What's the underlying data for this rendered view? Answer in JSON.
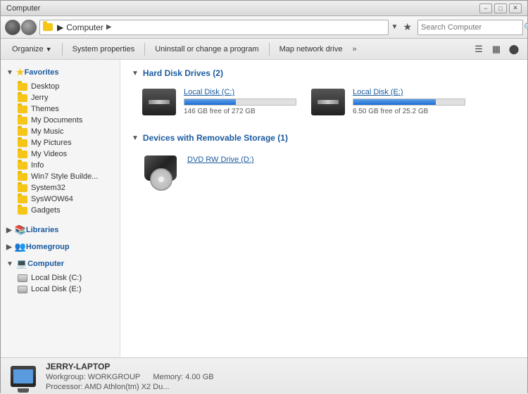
{
  "window": {
    "title": "Computer",
    "min_btn": "−",
    "max_btn": "□",
    "close_btn": "✕"
  },
  "addressbar": {
    "breadcrumb_icon": "folder",
    "breadcrumb_text": "Computer",
    "breadcrumb_arrow": "▶",
    "placeholder": "Search Computer",
    "star": "★",
    "dropdown_arrow": "▼"
  },
  "toolbar": {
    "organize_label": "Organize",
    "system_properties_label": "System properties",
    "uninstall_label": "Uninstall or change a program",
    "map_network_label": "Map network drive",
    "more_label": "»"
  },
  "sidebar": {
    "favorites_label": "Favorites",
    "favorites_items": [
      {
        "label": "Desktop"
      },
      {
        "label": "Jerry"
      },
      {
        "label": "Themes"
      },
      {
        "label": "My Documents"
      },
      {
        "label": "My Music"
      },
      {
        "label": "My Pictures"
      },
      {
        "label": "My Videos"
      },
      {
        "label": "Info"
      },
      {
        "label": "Win7 Style Builde..."
      },
      {
        "label": "System32"
      },
      {
        "label": "SysWOW64"
      },
      {
        "label": "Gadgets"
      }
    ],
    "libraries_label": "Libraries",
    "homegroup_label": "Homegroup",
    "computer_label": "Computer",
    "computer_items": [
      {
        "label": "Local Disk (C:)"
      },
      {
        "label": "Local Disk (E:)"
      }
    ]
  },
  "content": {
    "hard_disk_section": "Hard Disk Drives (2)",
    "drives": [
      {
        "name": "Local Disk (C:)",
        "free": "146 GB free of 272 GB",
        "progress_pct": 46,
        "type": "hdd"
      },
      {
        "name": "Local Disk (E:)",
        "free": "6.50 GB free of 25.2 GB",
        "progress_pct": 74,
        "type": "hdd"
      }
    ],
    "removable_section": "Devices with Removable Storage (1)",
    "removable_drives": [
      {
        "name": "DVD RW Drive (D:)",
        "type": "dvd"
      }
    ]
  },
  "statusbar": {
    "computer_name": "JERRY-LAPTOP",
    "workgroup": "Workgroup: WORKGROUP",
    "memory": "Memory: 4.00 GB",
    "processor": "Processor: AMD Athlon(tm) X2 Du..."
  }
}
